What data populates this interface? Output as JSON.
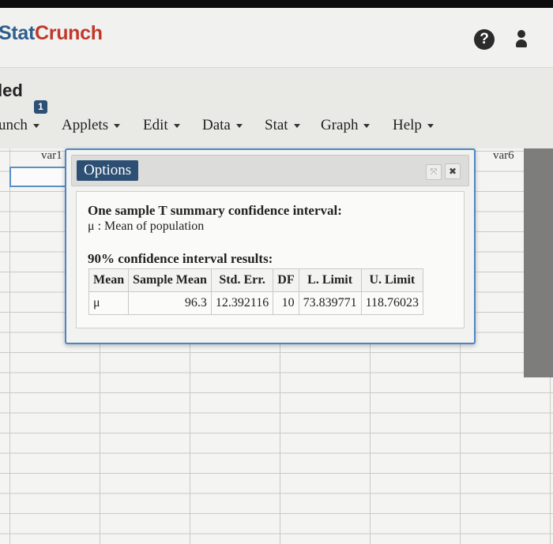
{
  "brand": {
    "part1": "Stat",
    "part2": "Crunch"
  },
  "header_icons": {
    "help": "question-circle-icon",
    "help_glyph": "?",
    "user": "user-icon"
  },
  "doc_title": "led",
  "notification_count": "1",
  "menu": [
    "unch",
    "Applets",
    "Edit",
    "Data",
    "Stat",
    "Graph",
    "Help"
  ],
  "grid": {
    "columns": [
      "var1",
      "var6"
    ]
  },
  "dialog": {
    "tab_label": "Options",
    "controls": {
      "expand": "expand-icon",
      "expand_glyph": "⤧",
      "close": "close-icon",
      "close_glyph": "✖"
    },
    "title": "One sample T summary confidence interval:",
    "subtitle": "μ : Mean of population",
    "ci_heading": "90% confidence interval results:",
    "table": {
      "headers": [
        "Mean",
        "Sample Mean",
        "Std. Err.",
        "DF",
        "L. Limit",
        "U. Limit"
      ],
      "row": [
        "μ",
        "96.3",
        "12.392116",
        "10",
        "73.839771",
        "118.76023"
      ]
    }
  },
  "colors": {
    "accent": "#2c4f73",
    "dialog_border": "#4d86c6",
    "brand_stat": "#2f5e8e",
    "brand_crunch": "#c0392b"
  }
}
